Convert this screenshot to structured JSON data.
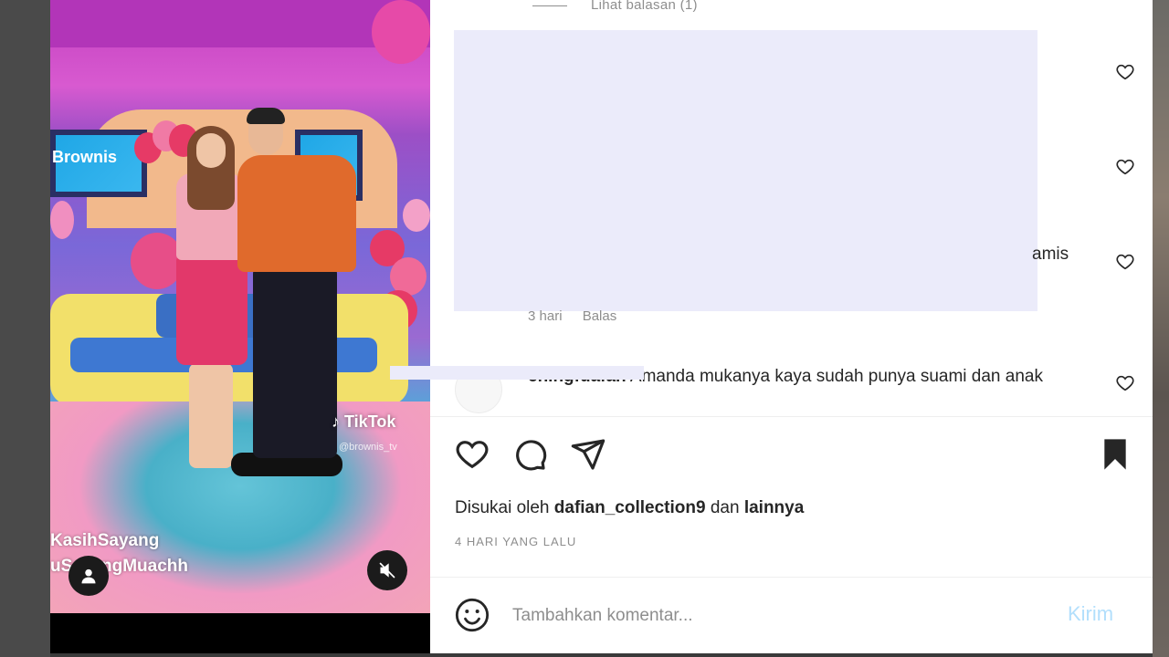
{
  "post": {
    "view_replies": "Lihat balasan (1)",
    "comment_fragment": "amis",
    "comment_meta": {
      "time": "3 hari",
      "reply": "Balas"
    },
    "comment": {
      "username": "chingfuafan",
      "text": "Amanda mukanya kaya sudah punya suami dan anak"
    },
    "likes": {
      "prefix": "Disukai oleh",
      "user": "dafian_collection9",
      "conjunction": "dan",
      "others": "lainnya"
    },
    "date": "4 HARI YANG LALU"
  },
  "composer": {
    "placeholder": "Tambahkan komentar...",
    "post_label": "Kirim"
  },
  "video": {
    "brand": "Brownis",
    "caption_line1": "KasihSayang",
    "caption_line2": "uSayangMuachh",
    "tiktok": "TikTok",
    "tiktok_handle": "@brownis_tv"
  },
  "colors": {
    "panel_bg": "#ffffff",
    "text_primary": "#262626",
    "text_secondary": "#8e8e8e",
    "post_disabled": "#b2dffc",
    "redaction": "#ebebfa"
  },
  "icons": [
    "heart-icon",
    "comment-icon",
    "share-icon",
    "bookmark-icon",
    "emoji-icon",
    "mute-icon",
    "user-icon"
  ]
}
